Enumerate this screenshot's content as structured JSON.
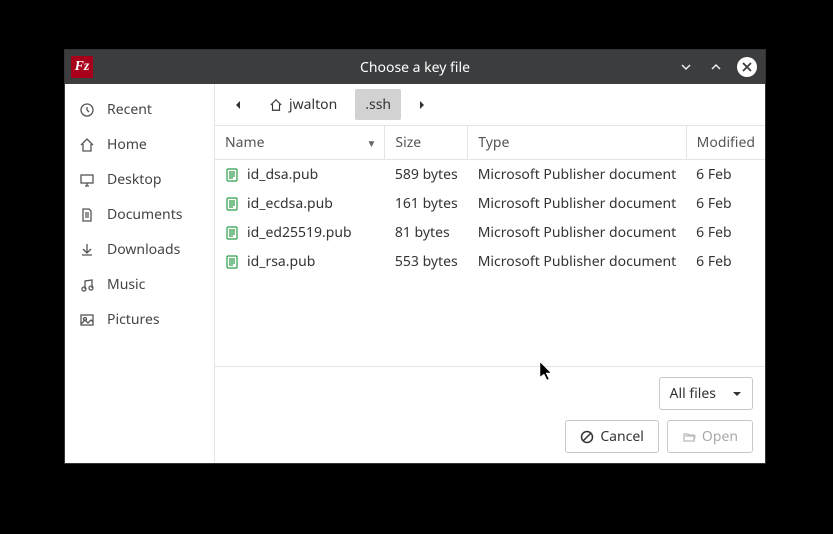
{
  "titlebar": {
    "title": "Choose a key file"
  },
  "sidebar": {
    "items": [
      {
        "label": "Recent"
      },
      {
        "label": "Home"
      },
      {
        "label": "Desktop"
      },
      {
        "label": "Documents"
      },
      {
        "label": "Downloads"
      },
      {
        "label": "Music"
      },
      {
        "label": "Pictures"
      }
    ]
  },
  "breadcrumb": {
    "parent": "jwalton",
    "current": ".ssh"
  },
  "columns": {
    "name": "Name",
    "size": "Size",
    "type": "Type",
    "modified": "Modified"
  },
  "files": [
    {
      "name": "id_dsa.pub",
      "size": "589 bytes",
      "type": "Microsoft Publisher document",
      "modified": "6 Feb"
    },
    {
      "name": "id_ecdsa.pub",
      "size": "161 bytes",
      "type": "Microsoft Publisher document",
      "modified": "6 Feb"
    },
    {
      "name": "id_ed25519.pub",
      "size": "81 bytes",
      "type": "Microsoft Publisher document",
      "modified": "6 Feb"
    },
    {
      "name": "id_rsa.pub",
      "size": "553 bytes",
      "type": "Microsoft Publisher document",
      "modified": "6 Feb"
    }
  ],
  "filter": {
    "label": "All files"
  },
  "buttons": {
    "cancel": "Cancel",
    "open": "Open"
  }
}
